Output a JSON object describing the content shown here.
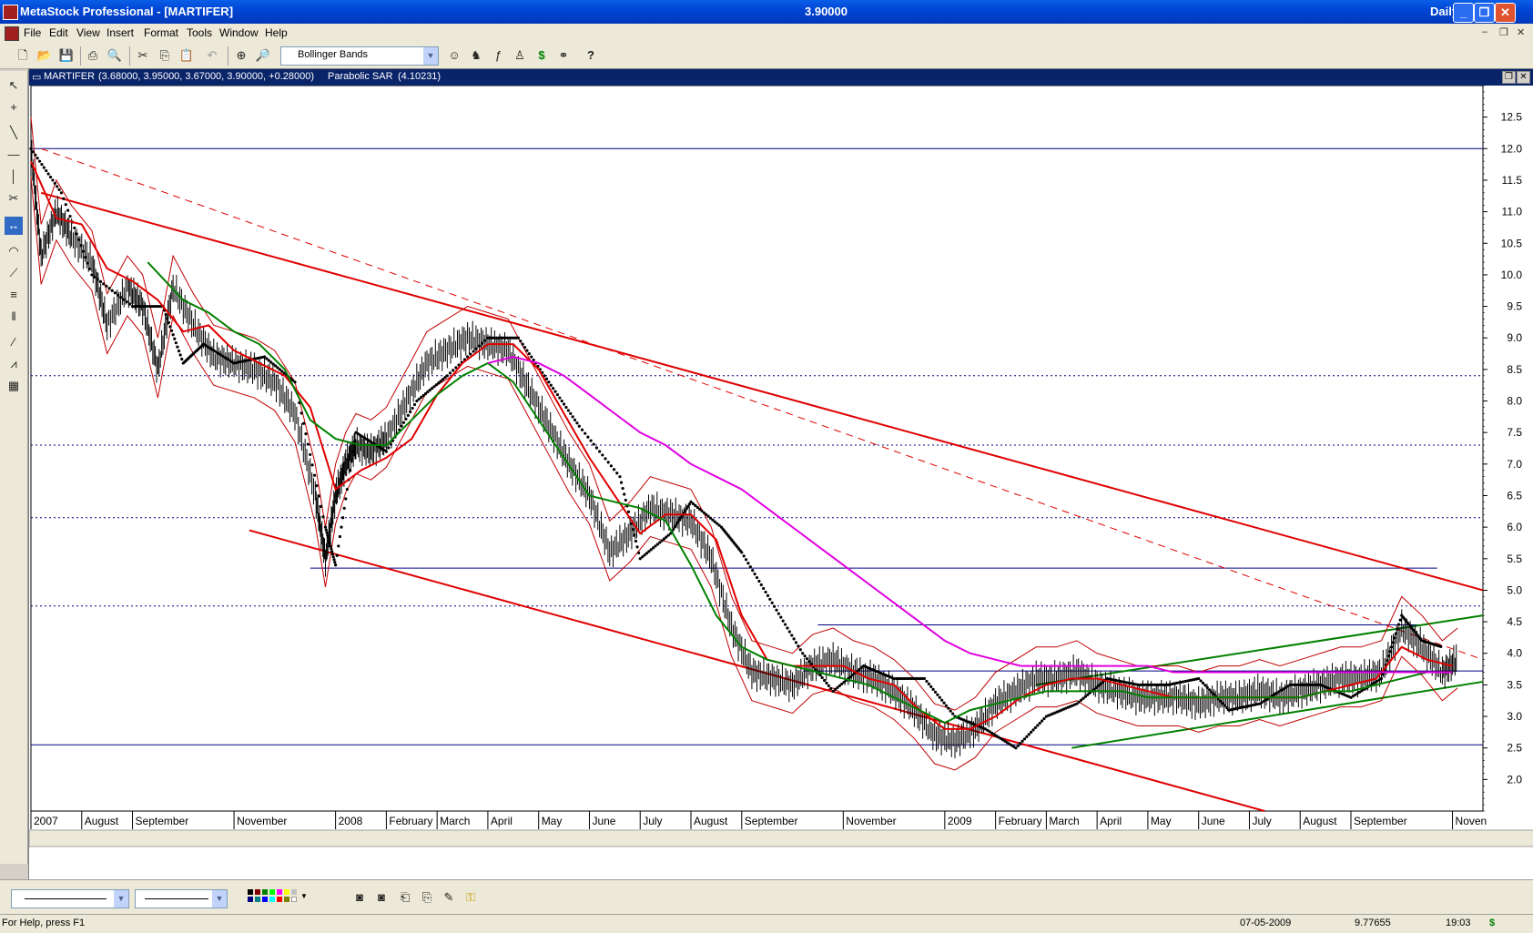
{
  "window": {
    "title": "MetaStock Professional - [MARTIFER]",
    "price": "3.90000",
    "period": "Daily"
  },
  "menu": [
    "File",
    "Edit",
    "View",
    "Insert",
    "Format",
    "Tools",
    "Window",
    "Help"
  ],
  "toolbar": {
    "indicator_select": "Bollinger Bands"
  },
  "chart_header": {
    "symbol": "MARTIFER",
    "ohlc": "(3.68000, 3.95000, 3.67000, 3.90000, +0.28000)",
    "indicator": "Parabolic SAR",
    "indicator_value": "(4.10231)"
  },
  "chart_data": {
    "type": "line",
    "ylim": [
      1.5,
      13.0
    ],
    "y_ticks": [
      2.0,
      2.5,
      3.0,
      3.5,
      4.0,
      4.5,
      5.0,
      5.5,
      6.0,
      6.5,
      7.0,
      7.5,
      8.0,
      8.5,
      9.0,
      9.5,
      10.0,
      10.5,
      11.0,
      11.5,
      12.0,
      12.5
    ],
    "y_tick_labels": [
      "2.0",
      "2.5",
      "3.0",
      "3.5",
      "4.0",
      "4.5",
      "5.0",
      "5.5",
      "6.0",
      "6.5",
      "7.0",
      "7.5",
      "8.0",
      "8.5",
      "9.0",
      "9.5",
      "10.0",
      "10.5",
      "11.0",
      "11.5",
      "12.0",
      "12.5"
    ],
    "x_period": "2007-06 to 2009-11",
    "x_labels": [
      "2007",
      "August",
      "September",
      "November",
      "2008",
      "February",
      "March",
      "April",
      "May",
      "June",
      "July",
      "August",
      "September",
      "November",
      "2009",
      "February",
      "March",
      "April",
      "May",
      "June",
      "July",
      "August",
      "September",
      "Noven"
    ],
    "x_label_index": [
      0,
      1,
      2,
      4,
      6,
      7,
      8,
      9,
      10,
      11,
      12,
      13,
      14,
      16,
      18,
      19,
      20,
      21,
      22,
      23,
      24,
      25,
      26,
      28
    ],
    "series": [
      {
        "type": "price",
        "color": "#000000",
        "x": [
          0,
          0.2,
          0.5,
          0.8,
          1.2,
          1.5,
          1.9,
          2.2,
          2.5,
          2.8,
          3.2,
          3.6,
          4.0,
          4.4,
          4.8,
          5.2,
          5.6,
          5.8,
          6.0,
          6.2,
          6.4,
          6.7,
          7.0,
          7.4,
          7.8,
          8.2,
          8.6,
          9.0,
          9.4,
          9.8,
          10.2,
          10.6,
          11.0,
          11.4,
          11.8,
          12.2,
          12.6,
          13.0,
          13.4,
          13.8,
          14.2,
          14.6,
          15.0,
          15.4,
          15.8,
          16.2,
          16.6,
          17.0,
          17.4,
          17.8,
          18.2,
          18.6,
          19.0,
          19.4,
          19.8,
          20.2,
          20.6,
          21.0,
          21.4,
          21.8,
          22.2,
          22.6,
          23.0,
          23.4,
          23.8,
          24.2,
          24.6,
          25.0,
          25.4,
          25.8,
          26.2,
          26.6,
          27.0,
          27.4,
          27.8,
          28.1
        ],
        "values": [
          12.0,
          10.3,
          11.0,
          10.6,
          10.2,
          9.2,
          9.8,
          9.5,
          8.5,
          9.8,
          9.2,
          8.7,
          8.6,
          8.5,
          8.3,
          7.8,
          6.5,
          5.5,
          6.5,
          7.0,
          7.3,
          7.2,
          7.4,
          8.0,
          8.6,
          8.8,
          9.0,
          8.9,
          8.8,
          8.2,
          7.6,
          7.0,
          6.5,
          5.6,
          5.9,
          6.3,
          6.2,
          6.1,
          5.5,
          4.4,
          3.7,
          3.6,
          3.5,
          3.8,
          3.9,
          3.7,
          3.6,
          3.4,
          3.1,
          2.7,
          2.6,
          2.8,
          3.2,
          3.4,
          3.6,
          3.6,
          3.7,
          3.5,
          3.4,
          3.3,
          3.3,
          3.3,
          3.2,
          3.3,
          3.3,
          3.4,
          3.3,
          3.4,
          3.5,
          3.6,
          3.6,
          3.7,
          4.4,
          4.1,
          3.7,
          3.9
        ]
      },
      {
        "type": "sar",
        "color": "#000000",
        "x": [
          0,
          0.6,
          1.2,
          2.0,
          2.6,
          3.0,
          3.4,
          4.0,
          4.6,
          5.2,
          5.8,
          6.0,
          6.4,
          7.0,
          7.6,
          8.2,
          9.0,
          9.6,
          10.2,
          10.8,
          11.6,
          12.0,
          12.6,
          13.0,
          13.6,
          14.0,
          14.6,
          15.2,
          15.8,
          16.4,
          17.0,
          17.6,
          18.2,
          18.8,
          19.4,
          20.0,
          20.6,
          21.2,
          21.8,
          22.4,
          23.0,
          23.6,
          24.2,
          24.8,
          25.4,
          26.0,
          26.6,
          27.0,
          27.4,
          27.8
        ],
        "values": [
          12.0,
          11.3,
          10.0,
          9.5,
          9.5,
          8.6,
          8.9,
          8.6,
          8.7,
          8.3,
          6.0,
          5.4,
          7.5,
          7.2,
          8.0,
          8.4,
          9.0,
          9.0,
          8.3,
          7.6,
          6.8,
          5.5,
          5.9,
          6.4,
          6.0,
          5.6,
          4.8,
          4.0,
          3.4,
          3.8,
          3.6,
          3.6,
          3.0,
          2.8,
          2.5,
          3.0,
          3.2,
          3.6,
          3.5,
          3.5,
          3.6,
          3.1,
          3.2,
          3.5,
          3.5,
          3.3,
          3.6,
          4.6,
          4.2,
          4.1
        ]
      },
      {
        "name": "MA short",
        "color": "#e00000",
        "x": [
          0,
          0.5,
          1.0,
          1.5,
          2.0,
          2.5,
          3.0,
          3.5,
          4.0,
          4.5,
          5.0,
          5.5,
          6.0,
          6.5,
          7.0,
          7.5,
          8.0,
          8.5,
          9.0,
          9.5,
          10.0,
          10.5,
          11.0,
          11.5,
          12.0,
          12.5,
          13.0,
          13.5,
          14.0,
          14.5,
          15.0,
          15.5,
          16.0,
          16.5,
          17.0,
          17.5,
          18.0,
          18.5,
          19.0,
          19.5,
          20.0,
          20.5,
          21.0,
          21.5,
          22.0,
          22.5,
          23.0,
          23.5,
          24.0,
          24.5,
          25.0,
          25.5,
          26.0,
          26.5,
          27.0,
          27.5,
          28.0
        ],
        "values": [
          11.8,
          10.9,
          10.8,
          10.1,
          9.9,
          9.6,
          9.1,
          9.2,
          8.8,
          8.6,
          8.4,
          7.9,
          6.6,
          6.9,
          7.1,
          7.4,
          8.1,
          8.6,
          8.9,
          8.9,
          8.5,
          7.8,
          7.1,
          6.5,
          5.9,
          6.2,
          6.2,
          5.8,
          4.6,
          3.9,
          3.8,
          3.8,
          3.8,
          3.6,
          3.5,
          3.1,
          2.8,
          2.8,
          3.0,
          3.3,
          3.5,
          3.6,
          3.6,
          3.5,
          3.4,
          3.3,
          3.3,
          3.3,
          3.3,
          3.3,
          3.3,
          3.4,
          3.5,
          3.6,
          4.1,
          3.9,
          3.8
        ]
      },
      {
        "name": "MA medium",
        "color": "#008000",
        "x": [
          2.3,
          3.0,
          3.5,
          4.0,
          4.5,
          5.0,
          5.5,
          6.0,
          6.5,
          7.0,
          7.5,
          8.0,
          8.5,
          9.0,
          9.5,
          10.0,
          10.5,
          11.0,
          11.5,
          12.0,
          12.5,
          13.0,
          13.5,
          14.0,
          14.5,
          15.0,
          15.5,
          16.0,
          16.5,
          17.0,
          17.5,
          18.0,
          18.5,
          19.0,
          19.5,
          20.0,
          20.5,
          21.0,
          21.5,
          22.0,
          22.5,
          23.0,
          23.5,
          24.0,
          24.5,
          25.0,
          25.5,
          26.0,
          26.5,
          27.0,
          27.5,
          28.0
        ],
        "values": [
          10.2,
          9.6,
          9.4,
          9.1,
          8.9,
          8.5,
          7.7,
          7.4,
          7.3,
          7.3,
          7.7,
          8.1,
          8.4,
          8.6,
          8.3,
          7.7,
          7.1,
          6.5,
          6.4,
          6.3,
          6.1,
          5.4,
          4.6,
          4.1,
          3.9,
          3.8,
          3.7,
          3.6,
          3.5,
          3.3,
          3.1,
          2.9,
          3.1,
          3.2,
          3.3,
          3.4,
          3.4,
          3.4,
          3.4,
          3.3,
          3.3,
          3.3,
          3.3,
          3.3,
          3.3,
          3.3,
          3.4,
          3.4,
          3.5,
          3.6,
          3.7,
          3.7
        ]
      },
      {
        "name": "MA long",
        "color": "#e000e0",
        "x": [
          9.0,
          9.5,
          10.0,
          10.5,
          11.0,
          11.5,
          12.0,
          12.5,
          13.0,
          13.5,
          14.0,
          14.5,
          15.0,
          15.5,
          16.0,
          16.5,
          17.0,
          17.5,
          18.0,
          18.5,
          19.0,
          19.5,
          20.0,
          20.5,
          21.0,
          21.5,
          22.0,
          22.5,
          23.0,
          23.5,
          24.0,
          24.5,
          25.0,
          25.5,
          26.0,
          26.5,
          27.0,
          27.5,
          28.0
        ],
        "values": [
          8.6,
          8.7,
          8.6,
          8.4,
          8.1,
          7.8,
          7.5,
          7.3,
          7.0,
          6.8,
          6.6,
          6.3,
          6.0,
          5.7,
          5.4,
          5.1,
          4.8,
          4.5,
          4.2,
          4.0,
          3.9,
          3.8,
          3.8,
          3.8,
          3.8,
          3.8,
          3.8,
          3.7,
          3.7,
          3.7,
          3.7,
          3.7,
          3.7,
          3.7,
          3.7,
          3.7,
          3.7,
          3.7,
          3.7
        ]
      }
    ],
    "trendlines": [
      {
        "color": "#e00000",
        "style": "solid",
        "x1": 0.2,
        "y1": 11.3,
        "x2": 28.6,
        "y2": 5.0
      },
      {
        "color": "#e00000",
        "style": "solid",
        "x1": 4.3,
        "y1": 5.95,
        "x2": 24.3,
        "y2": 1.5
      },
      {
        "color": "#e00000",
        "style": "dashed",
        "x1": 0.2,
        "y1": 12.0,
        "x2": 28.6,
        "y2": 3.9
      },
      {
        "color": "#008000",
        "style": "solid",
        "x1": 19.8,
        "y1": 3.5,
        "x2": 28.6,
        "y2": 4.6
      },
      {
        "color": "#008000",
        "style": "solid",
        "x1": 20.5,
        "y1": 2.5,
        "x2": 28.6,
        "y2": 3.55
      }
    ],
    "hlines": [
      {
        "y": 12.0,
        "color": "#000080",
        "style": "solid",
        "x1": 0,
        "x2": 28.6
      },
      {
        "y": 8.4,
        "color": "#000080",
        "style": "dotted",
        "x1": 0,
        "x2": 28.6
      },
      {
        "y": 7.3,
        "color": "#000080",
        "style": "dotted",
        "x1": 0,
        "x2": 28.6
      },
      {
        "y": 6.15,
        "color": "#000080",
        "style": "dotted",
        "x1": 0,
        "x2": 28.6
      },
      {
        "y": 5.35,
        "color": "#000080",
        "style": "solid",
        "x1": 5.5,
        "x2": 27.7
      },
      {
        "y": 4.75,
        "color": "#000080",
        "style": "dotted",
        "x1": 0,
        "x2": 28.6
      },
      {
        "y": 4.45,
        "color": "#000080",
        "style": "solid",
        "x1": 15.5,
        "x2": 27.5
      },
      {
        "y": 3.72,
        "color": "#000080",
        "style": "solid",
        "x1": 15.2,
        "x2": 28.6
      },
      {
        "y": 2.55,
        "color": "#000080",
        "style": "solid",
        "x1": 0,
        "x2": 28.6
      }
    ]
  },
  "bottom_status": {
    "help": "For Help, press F1",
    "date": "07-05-2009",
    "value": "9.77655",
    "time": "19:03",
    "currency": "$"
  }
}
